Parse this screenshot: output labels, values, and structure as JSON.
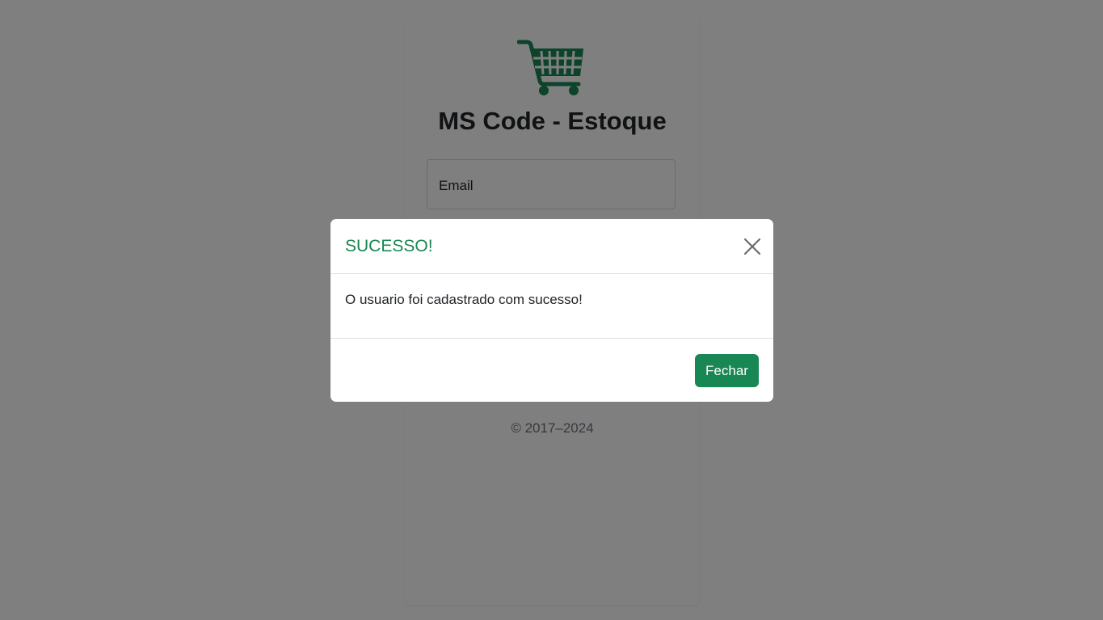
{
  "login": {
    "brand_title": "MS Code - Estoque",
    "email_placeholder": "Email",
    "copyright": "© 2017–2024",
    "logo_icon": "shopping-cart-icon",
    "accent_color": "#198754"
  },
  "modal": {
    "title": "SUCESSO!",
    "message": "O usuario foi cadastrado com sucesso!",
    "close_icon": "close-icon",
    "button_label": "Fechar",
    "title_color": "#198754",
    "button_color": "#198754"
  }
}
